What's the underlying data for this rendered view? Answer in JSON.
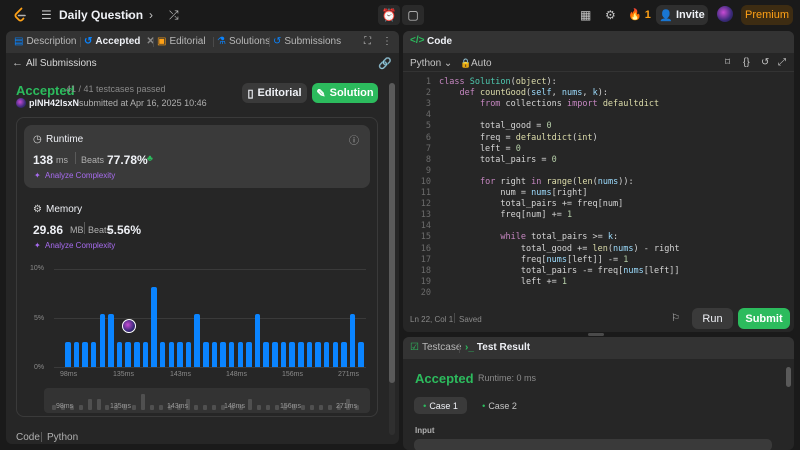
{
  "topbar": {
    "title": "Daily Question",
    "streak": "1",
    "invite_label": "Invite",
    "premium_label": "Premium"
  },
  "left_tabs": [
    {
      "label": "Description"
    },
    {
      "label": "Accepted"
    },
    {
      "label": "Editorial"
    },
    {
      "label": "Solutions"
    },
    {
      "label": "Submissions"
    }
  ],
  "submission": {
    "back_label": "All Submissions",
    "status": "Accepted",
    "testcases": "41 / 41 testcases passed",
    "user": "plNH42lsxN",
    "submitted": "submitted at Apr 16, 2025 10:46",
    "editorial_label": "Editorial",
    "solution_label": "Solution"
  },
  "runtime": {
    "label": "Runtime",
    "value": "138",
    "unit": "ms",
    "beats_label": "Beats",
    "beats": "77.78%",
    "analyze": "Analyze Complexity"
  },
  "memory": {
    "label": "Memory",
    "value": "29.86",
    "unit": "MB",
    "beats_label": "Beats",
    "beats": "5.56%",
    "analyze": "Analyze Complexity"
  },
  "chart_data": {
    "type": "bar",
    "y_ticks": [
      "10%",
      "5%",
      "0%"
    ],
    "ylim": [
      0,
      10
    ],
    "x_ticks": [
      "98ms",
      "135ms",
      "143ms",
      "148ms",
      "156ms",
      "271ms"
    ],
    "values": [
      2.6,
      2.6,
      2.6,
      2.6,
      5.4,
      5.4,
      2.6,
      2.6,
      2.6,
      2.6,
      8.2,
      2.6,
      2.6,
      2.6,
      2.6,
      5.4,
      2.6,
      2.6,
      2.6,
      2.6,
      2.6,
      2.6,
      5.4,
      2.6,
      2.6,
      2.6,
      2.6,
      2.6,
      2.6,
      2.6,
      2.6,
      2.6,
      2.6,
      5.4,
      2.6
    ],
    "mini_ticks": [
      "98ms",
      "135ms",
      "143ms",
      "148ms",
      "156ms",
      "271ms"
    ]
  },
  "footer_code": {
    "label": "Code",
    "lang": "Python"
  },
  "code_panel": {
    "title": "Code",
    "language": "Python",
    "auto": "Auto",
    "status_pos": "Ln 22, Col 1",
    "status_saved": "Saved",
    "run_label": "Run",
    "submit_label": "Submit"
  },
  "code_lines": [
    "class Solution(object):",
    "    def countGood(self, nums, k):",
    "        from collections import defaultdict",
    "",
    "        total_good = 0",
    "        freq = defaultdict(int)",
    "        left = 0",
    "        total_pairs = 0",
    "",
    "        for right in range(len(nums)):",
    "            num = nums[right]",
    "            total_pairs += freq[num]",
    "            freq[num] += 1",
    "",
    "            while total_pairs >= k:",
    "                total_good += len(nums) - right",
    "                freq[nums[left]] -= 1",
    "                total_pairs -= freq[nums[left]]",
    "                left += 1",
    ""
  ],
  "result_panel": {
    "testcase_tab": "Testcase",
    "result_tab": "Test Result",
    "status": "Accepted",
    "runtime": "Runtime: 0 ms",
    "case1": "Case 1",
    "case2": "Case 2",
    "input_label": "Input"
  }
}
